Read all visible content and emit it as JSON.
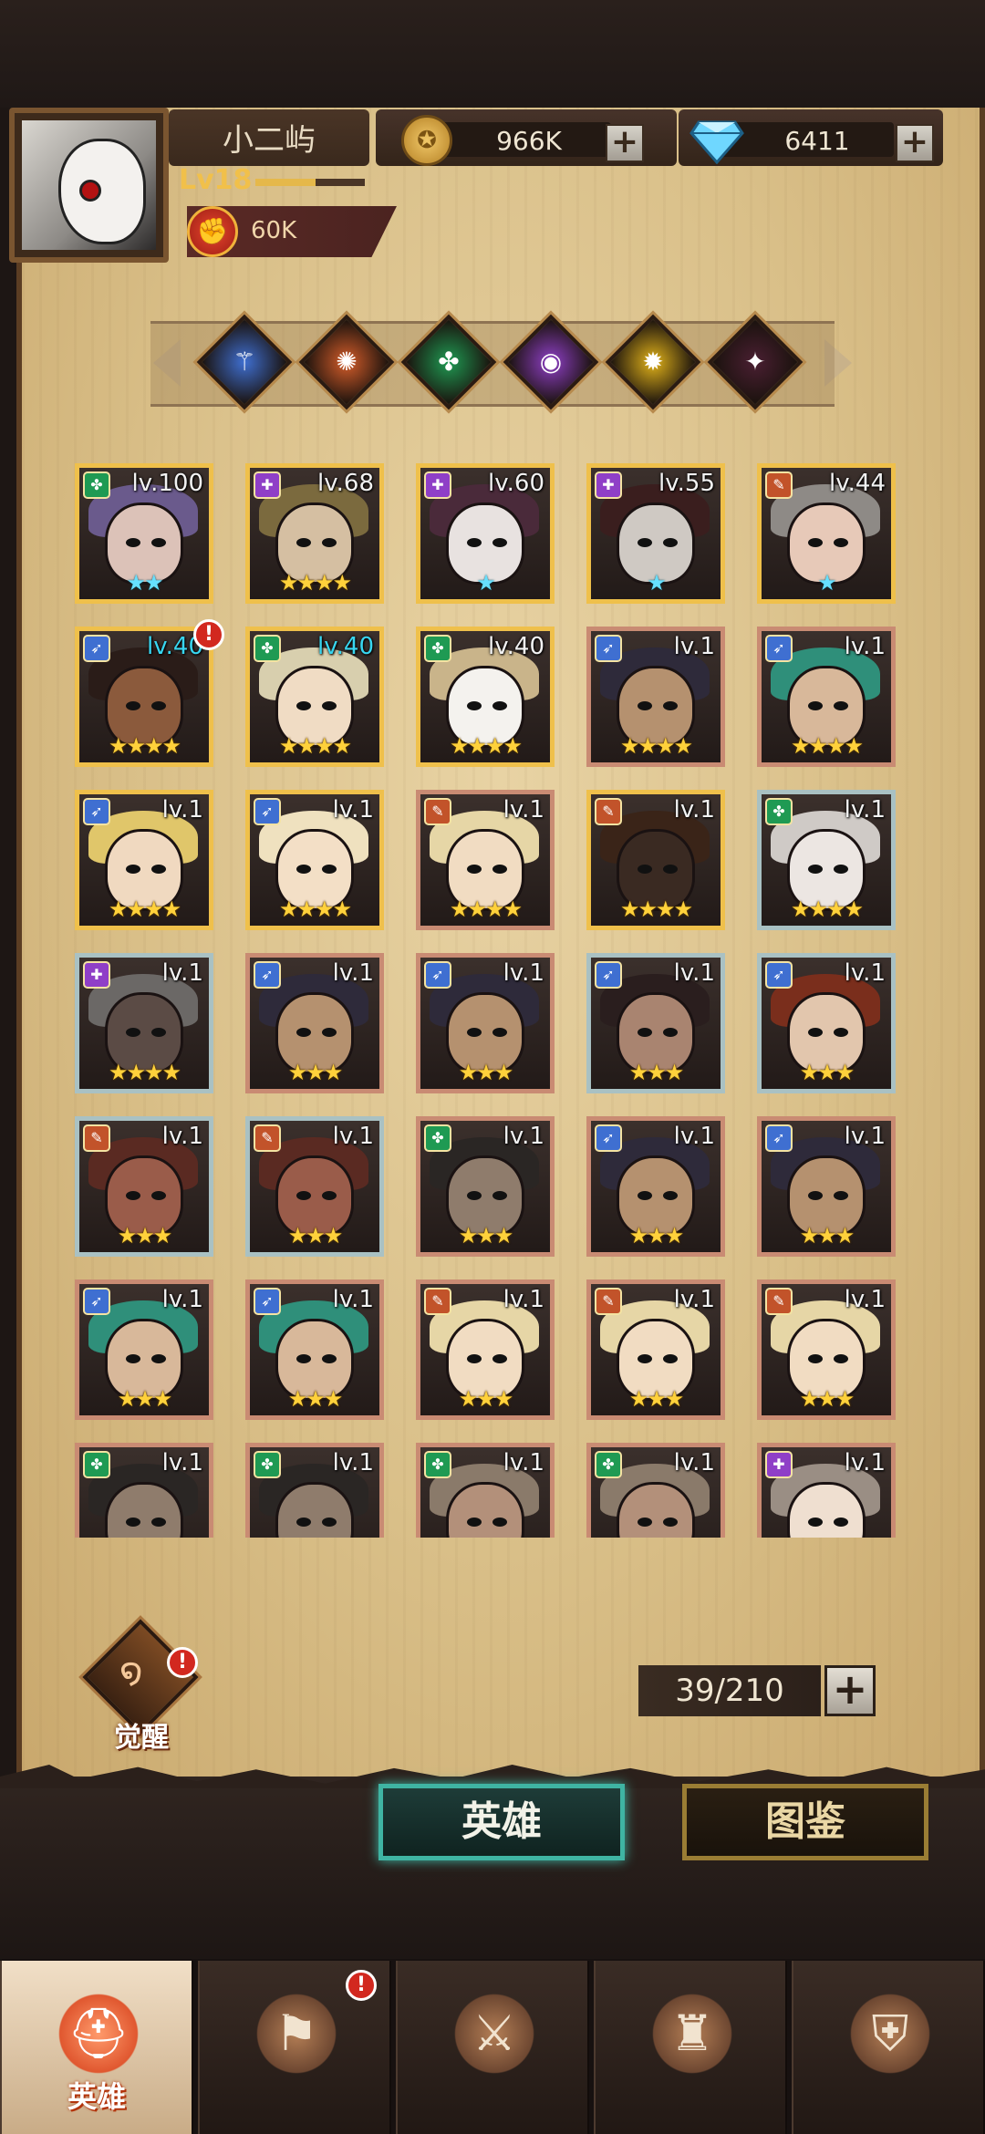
{
  "player": {
    "name": "小二屿",
    "level_label": "Lv18",
    "xp_fraction": 0.55,
    "power": "60K"
  },
  "resources": {
    "gold": "966K",
    "gems": "6411",
    "plus_symbol": "+"
  },
  "factions": [
    {
      "icon": "wind-faction-icon",
      "color": "#3f6fd1",
      "glyph": "⚚"
    },
    {
      "icon": "fire-faction-icon",
      "color": "#d55d2a",
      "glyph": "✺"
    },
    {
      "icon": "nature-faction-icon",
      "color": "#1f9a53",
      "glyph": "✤"
    },
    {
      "icon": "shadow-faction-icon",
      "color": "#8f3fc7",
      "glyph": "◉"
    },
    {
      "icon": "light-faction-icon",
      "color": "#e2b31a",
      "glyph": "✹"
    },
    {
      "icon": "dark-faction-icon",
      "color": "#4a1f32",
      "glyph": "✦"
    }
  ],
  "heroes": [
    {
      "level": "lv.100",
      "stars": 2,
      "special": true,
      "frame": "gold",
      "cls": "#1f9a53",
      "hair": "#6a5a8c",
      "skin": "#dcc2b8"
    },
    {
      "level": "lv.68",
      "stars": 4,
      "frame": "gold",
      "cls": "#8f3fc7",
      "hair": "#7b6a3e",
      "skin": "#d5bfa2"
    },
    {
      "level": "lv.60",
      "stars": 1,
      "special": true,
      "frame": "gold",
      "cls": "#8f3fc7",
      "hair": "#4a2a3a",
      "skin": "#e8e2e0"
    },
    {
      "level": "lv.55",
      "stars": 1,
      "special": true,
      "frame": "gold",
      "cls": "#8f3fc7",
      "hair": "#3a1e1e",
      "skin": "#cfc9c3"
    },
    {
      "level": "lv.44",
      "stars": 1,
      "special": true,
      "frame": "gold",
      "cls": "#c2532a",
      "hair": "#8e8a86",
      "skin": "#e7c9b8"
    },
    {
      "level": "lv.40",
      "cyan": true,
      "stars": 4,
      "frame": "gold",
      "cls": "#3f6fd1",
      "hair": "#2a1c18",
      "skin": "#8b5a3c",
      "alert": true
    },
    {
      "level": "lv.40",
      "cyan": true,
      "stars": 4,
      "frame": "gold",
      "cls": "#1f9a53",
      "hair": "#d8cfae",
      "skin": "#f0dcc4"
    },
    {
      "level": "lv.40",
      "stars": 4,
      "frame": "gold",
      "cls": "#1f9a53",
      "hair": "#c9b48a",
      "skin": "#f4f2ee"
    },
    {
      "level": "lv.1",
      "stars": 4,
      "frame": "bronze",
      "cls": "#3f6fd1",
      "hair": "#2e2a3a",
      "skin": "#b5916f"
    },
    {
      "level": "lv.1",
      "stars": 4,
      "frame": "bronze",
      "cls": "#3f6fd1",
      "hair": "#2f8f7a",
      "skin": "#d8b89a"
    },
    {
      "level": "lv.1",
      "stars": 4,
      "frame": "gold",
      "cls": "#3f6fd1",
      "hair": "#e0c66a",
      "skin": "#f0d9c0"
    },
    {
      "level": "lv.1",
      "stars": 4,
      "frame": "gold",
      "cls": "#3f6fd1",
      "hair": "#efe1bf",
      "skin": "#f3dfc6"
    },
    {
      "level": "lv.1",
      "stars": 4,
      "frame": "bronze",
      "cls": "#c2532a",
      "hair": "#e6d6a6",
      "skin": "#f1dcc2"
    },
    {
      "level": "lv.1",
      "stars": 4,
      "frame": "gold",
      "cls": "#c2532a",
      "hair": "#3a2418",
      "skin": "#3a2a22"
    },
    {
      "level": "lv.1",
      "stars": 4,
      "frame": "silver",
      "cls": "#1f9a53",
      "hair": "#cfcac6",
      "skin": "#ece6e2"
    },
    {
      "level": "lv.1",
      "stars": 4,
      "frame": "silver",
      "cls": "#8f3fc7",
      "hair": "#6b6866",
      "skin": "#5b4b45"
    },
    {
      "level": "lv.1",
      "stars": 3,
      "frame": "bronze",
      "cls": "#3f6fd1",
      "hair": "#2e2a3a",
      "skin": "#b5916f"
    },
    {
      "level": "lv.1",
      "stars": 3,
      "frame": "bronze",
      "cls": "#3f6fd1",
      "hair": "#2e2a3a",
      "skin": "#b5916f"
    },
    {
      "level": "lv.1",
      "stars": 3,
      "frame": "silver",
      "cls": "#3f6fd1",
      "hair": "#2a1e1e",
      "skin": "#a98470"
    },
    {
      "level": "lv.1",
      "stars": 3,
      "frame": "silver",
      "cls": "#3f6fd1",
      "hair": "#7a2e1c",
      "skin": "#e2c6ad"
    },
    {
      "level": "lv.1",
      "stars": 3,
      "frame": "silver",
      "cls": "#c2532a",
      "hair": "#5a2a22",
      "skin": "#9a5c4a"
    },
    {
      "level": "lv.1",
      "stars": 3,
      "frame": "silver",
      "cls": "#c2532a",
      "hair": "#5a2a22",
      "skin": "#9a5c4a"
    },
    {
      "level": "lv.1",
      "stars": 3,
      "frame": "bronze",
      "cls": "#1f9a53",
      "hair": "#2a2624",
      "skin": "#8f7c6c"
    },
    {
      "level": "lv.1",
      "stars": 3,
      "frame": "bronze",
      "cls": "#3f6fd1",
      "hair": "#2e2a3a",
      "skin": "#b5916f"
    },
    {
      "level": "lv.1",
      "stars": 3,
      "frame": "bronze",
      "cls": "#3f6fd1",
      "hair": "#2e2a3a",
      "skin": "#b5916f"
    },
    {
      "level": "lv.1",
      "stars": 3,
      "frame": "bronze",
      "cls": "#3f6fd1",
      "hair": "#2f8f7a",
      "skin": "#d8b89a"
    },
    {
      "level": "lv.1",
      "stars": 3,
      "frame": "bronze",
      "cls": "#3f6fd1",
      "hair": "#2f8f7a",
      "skin": "#d8b89a"
    },
    {
      "level": "lv.1",
      "stars": 3,
      "frame": "bronze",
      "cls": "#c2532a",
      "hair": "#e6d6a6",
      "skin": "#f1dcc2"
    },
    {
      "level": "lv.1",
      "stars": 3,
      "frame": "bronze",
      "cls": "#c2532a",
      "hair": "#e6d6a6",
      "skin": "#f1dcc2"
    },
    {
      "level": "lv.1",
      "stars": 3,
      "frame": "bronze",
      "cls": "#c2532a",
      "hair": "#e6d6a6",
      "skin": "#f1dcc2"
    },
    {
      "level": "lv.1",
      "stars": 0,
      "frame": "bronze",
      "cls": "#1f9a53",
      "hair": "#2a2624",
      "skin": "#8f7c6c"
    },
    {
      "level": "lv.1",
      "stars": 0,
      "frame": "bronze",
      "cls": "#1f9a53",
      "hair": "#2a2624",
      "skin": "#8f7c6c"
    },
    {
      "level": "lv.1",
      "stars": 0,
      "frame": "bronze",
      "cls": "#1f9a53",
      "hair": "#8a7a6a",
      "skin": "#b3907a"
    },
    {
      "level": "lv.1",
      "stars": 0,
      "frame": "bronze",
      "cls": "#1f9a53",
      "hair": "#8a7a6a",
      "skin": "#b3907a"
    },
    {
      "level": "lv.1",
      "stars": 0,
      "frame": "bronze",
      "cls": "#8f3fc7",
      "hair": "#9a8e84",
      "skin": "#efdfd0"
    }
  ],
  "awaken_label": "觉醒",
  "hero_count": "39/210",
  "tabs": {
    "heroes": "英雄",
    "codex": "图鉴"
  },
  "nav": [
    {
      "label": "英雄",
      "icon": "hero-helmet-icon",
      "active": true
    },
    {
      "label": "",
      "icon": "adventure-flag-icon",
      "alert": true
    },
    {
      "label": "",
      "icon": "battle-swords-icon"
    },
    {
      "label": "",
      "icon": "castle-tower-icon"
    },
    {
      "label": "",
      "icon": "guild-shield-icon"
    }
  ]
}
